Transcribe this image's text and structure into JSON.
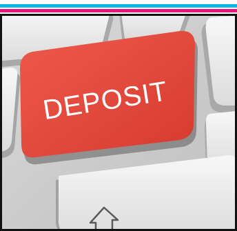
{
  "photo": {
    "key_label": "DEPOSIT",
    "subject": "keyboard-with-red-key",
    "key_color": "#e8453a",
    "stripe_colors": [
      "#12b4e6",
      "#e2177f"
    ]
  }
}
